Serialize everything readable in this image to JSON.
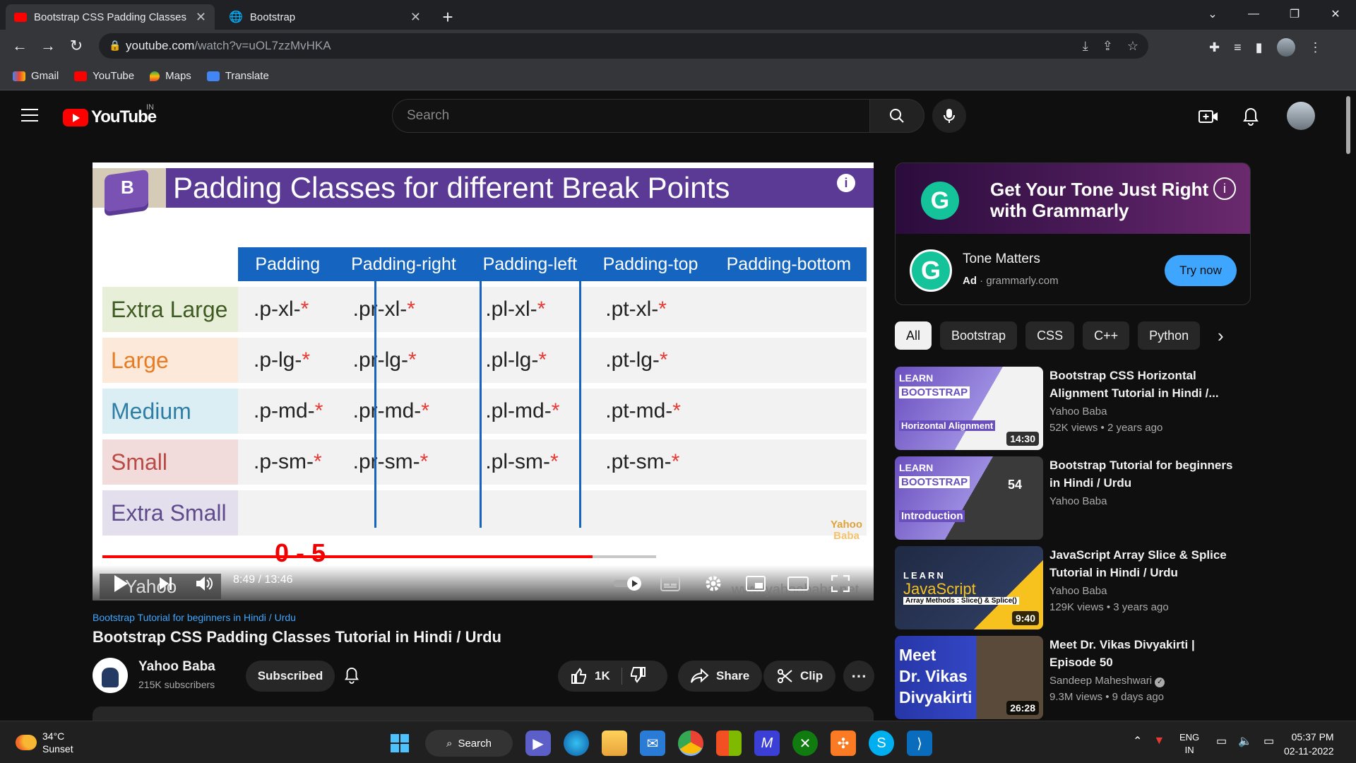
{
  "browser": {
    "tabs": [
      {
        "title": "Bootstrap CSS Padding Classes T"
      },
      {
        "title": "Bootstrap"
      }
    ],
    "url_host": "youtube.com",
    "url_path": "/watch?v=uOL7zzMvHKA",
    "bookmarks": [
      "Gmail",
      "YouTube",
      "Maps",
      "Translate"
    ]
  },
  "youtube": {
    "logo_text": "YouTube",
    "country_code": "IN",
    "search_placeholder": "Search"
  },
  "video": {
    "slide_title": "Padding Classes for different Break Points",
    "table_headers": [
      "Padding",
      "Padding-right",
      "Padding-left",
      "Padding-top",
      "Padding-bottom"
    ],
    "rows": [
      {
        "label": "Extra Large",
        "color": "#e8efd9",
        "text_color": "#3e5b22",
        "cells": [
          ".p-xl-",
          ".pr-xl-",
          ".pl-xl-",
          ".pt-xl-"
        ]
      },
      {
        "label": "Large",
        "color": "#fde9d9",
        "text_color": "#e87c24",
        "cells": [
          ".p-lg-",
          ".pr-lg-",
          ".pl-lg-",
          ".pt-lg-"
        ]
      },
      {
        "label": "Medium",
        "color": "#dbeef4",
        "text_color": "#2f7fa5",
        "cells": [
          ".p-md-",
          ".pr-md-",
          ".pl-md-",
          ".pt-md-"
        ]
      },
      {
        "label": "Small",
        "color": "#f2dcdb",
        "text_color": "#b94a45",
        "cells": [
          ".p-sm-",
          ".pr-sm-",
          ".pl-sm-",
          ".pt-sm-"
        ]
      },
      {
        "label": "Extra Small",
        "color": "#e4dfec",
        "text_color": "#5f4b8b",
        "cells": [
          "",
          "",
          "",
          ""
        ]
      }
    ],
    "star": "*",
    "watermark_line1": "Yahoo",
    "watermark_line2": "Baba",
    "red_annotation": "0 - 5",
    "time": "8:49 / 13:46",
    "progress": 0.641,
    "buffered": 0.725,
    "channel_badge": "Yahoo Baba",
    "url_watermark": "www.yahoobaba.net",
    "playlist_link": "Bootstrap Tutorial for beginners in Hindi / Urdu",
    "title": "Bootstrap CSS Padding Classes Tutorial in Hindi / Urdu",
    "channel": "Yahoo Baba",
    "subscribers": "215K subscribers",
    "subscribe_label": "Subscribed",
    "likes": "1K",
    "share_label": "Share",
    "clip_label": "Clip"
  },
  "ad": {
    "banner_text_line1": "Get Your Tone Just Right",
    "banner_text_line2": "with Grammarly",
    "logo_letter": "G",
    "name": "Tone Matters",
    "ad_label": "Ad",
    "domain": "· grammarly.com",
    "cta": "Try now"
  },
  "chips": [
    "All",
    "Bootstrap",
    "CSS",
    "C++",
    "Python"
  ],
  "recommendations": [
    {
      "title": "Bootstrap CSS Horizontal Alignment Tutorial in Hindi /...",
      "channel": "Yahoo Baba",
      "meta": "52K views • 2 years ago",
      "duration": "14:30",
      "thumb_top": "LEARN",
      "thumb_mid": "BOOTSTRAP",
      "thumb_bottom": "Horizontal Alignment"
    },
    {
      "title": "Bootstrap Tutorial for beginners in Hindi / Urdu",
      "channel": "Yahoo Baba",
      "meta": "",
      "duration": "54",
      "thumb_top": "LEARN",
      "thumb_mid": "BOOTSTRAP",
      "thumb_bottom": "Introduction"
    },
    {
      "title": "JavaScript Array Slice & Splice Tutorial in Hindi / Urdu",
      "channel": "Yahoo Baba",
      "meta": "129K views • 3 years ago",
      "duration": "9:40",
      "thumb_top": "LEARN",
      "thumb_mid": "JavaScript",
      "thumb_bottom": "Array Methods : Slice() & Splice()"
    },
    {
      "title": "Meet Dr. Vikas Divyakirti | Episode 50",
      "channel": "Sandeep Maheshwari",
      "meta": "9.3M views • 9 days ago",
      "duration": "26:28",
      "thumb_top": "Meet",
      "thumb_mid": "Dr. Vikas",
      "thumb_bottom": "Divyakirti"
    }
  ],
  "taskbar": {
    "temperature": "34°C",
    "weather": "Sunset",
    "search_label": "Search",
    "lang1": "ENG",
    "lang2": "IN",
    "time": "05:37 PM",
    "date": "02-11-2022"
  }
}
